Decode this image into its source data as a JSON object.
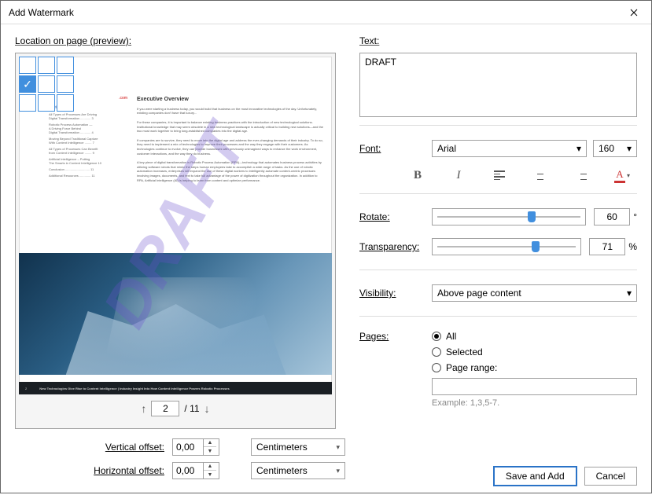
{
  "window": {
    "title": "Add Watermark"
  },
  "left": {
    "location_label": "Location on page (preview):",
    "selected_cell": 3,
    "preview": {
      "title": "Executive Overview",
      "sidebar_heading": "ntents",
      "sidebar_url": ".com",
      "body_snippet": "If you were starting a business today, you would build that business on the most innovative technologies of the day. Unfortunately, existing companies don't have that luxury...",
      "watermark_text": "DRAFT",
      "footer_text": "New Technologies Give Rise to Content Intelligence | Industry Insight Into How Content Intelligence Powers Robotic Processes",
      "page_num_footer": "2"
    },
    "pager": {
      "current": "2",
      "total": "11"
    },
    "offsets": {
      "vertical_label": "Vertical offset:",
      "vertical_value": "0,00",
      "horizontal_label": "Horizontal offset:",
      "horizontal_value": "0,00",
      "unit": "Centimeters"
    }
  },
  "right": {
    "text_label": "Text:",
    "text_value": "DRAFT",
    "font_label": "Font:",
    "font_name": "Arial",
    "font_size": "160",
    "rotate_label": "Rotate:",
    "rotate_value": "60",
    "rotate_unit": "°",
    "transparency_label": "Transparency:",
    "transparency_value": "71",
    "transparency_unit": "%",
    "visibility_label": "Visibility:",
    "visibility_value": "Above page content",
    "pages_label": "Pages:",
    "pages_options": {
      "all": "All",
      "selected": "Selected",
      "range": "Page range:"
    },
    "pages_selected": "all",
    "range_hint": "Example: 1,3,5-7.",
    "buttons": {
      "save": "Save and Add",
      "cancel": "Cancel"
    }
  }
}
